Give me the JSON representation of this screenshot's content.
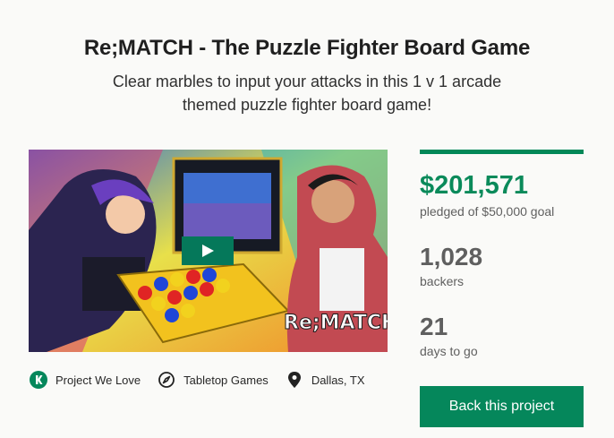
{
  "project": {
    "title": "Re;MATCH - The Puzzle Fighter Board Game",
    "blurb": "Clear marbles to input your attacks in this 1 v 1 arcade themed puzzle fighter board game!"
  },
  "video": {
    "logo_text": "Re;MATCH",
    "play_icon": "play-icon"
  },
  "tags": [
    {
      "label": "Project We Love",
      "icon": "kickstarter-badge-icon"
    },
    {
      "label": "Tabletop Games",
      "icon": "compass-icon"
    },
    {
      "label": "Dallas, TX",
      "icon": "location-pin-icon"
    }
  ],
  "stats": {
    "funding_progress": 1.0,
    "pledged": "$201,571",
    "pledged_sub": "pledged of $50,000 goal",
    "backers": "1,028",
    "backers_sub": "backers",
    "days": "21",
    "days_sub": "days to go"
  },
  "cta": {
    "label": "Back this project"
  },
  "colors": {
    "accent": "#05875b",
    "pledged_text": "#0a8a5a",
    "progress": "#028858"
  }
}
